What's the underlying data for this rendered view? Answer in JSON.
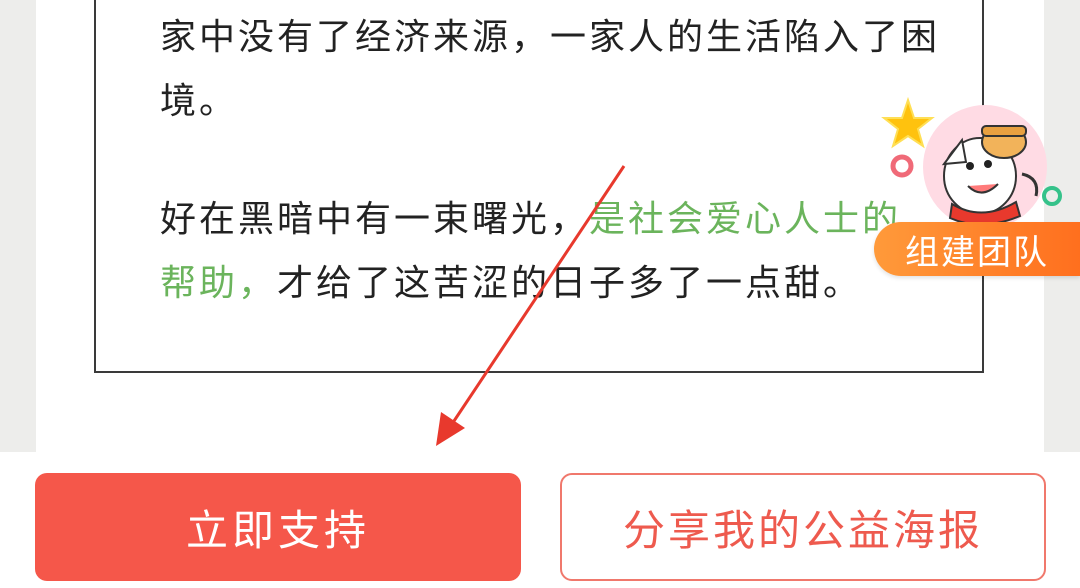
{
  "story": {
    "para1": "家中没有了经济来源，一家人的生活陷入了困境。",
    "para2_start": "好在黑暗中有一束曙光，",
    "para2_highlight": "是社会爱心人士的帮助，",
    "para2_end": "才给了这苦涩的日子多了一点甜。"
  },
  "team_widget": {
    "label": "组建团队",
    "avatar_icon": "cartoon-mascot-avatar"
  },
  "actions": {
    "support_label": "立即支持",
    "share_label": "分享我的公益海报"
  },
  "colors": {
    "primary": "#f5574a",
    "highlight_text": "#6bb45c",
    "annotation_arrow": "#e8392d",
    "team_badge": "#ff7a24"
  }
}
